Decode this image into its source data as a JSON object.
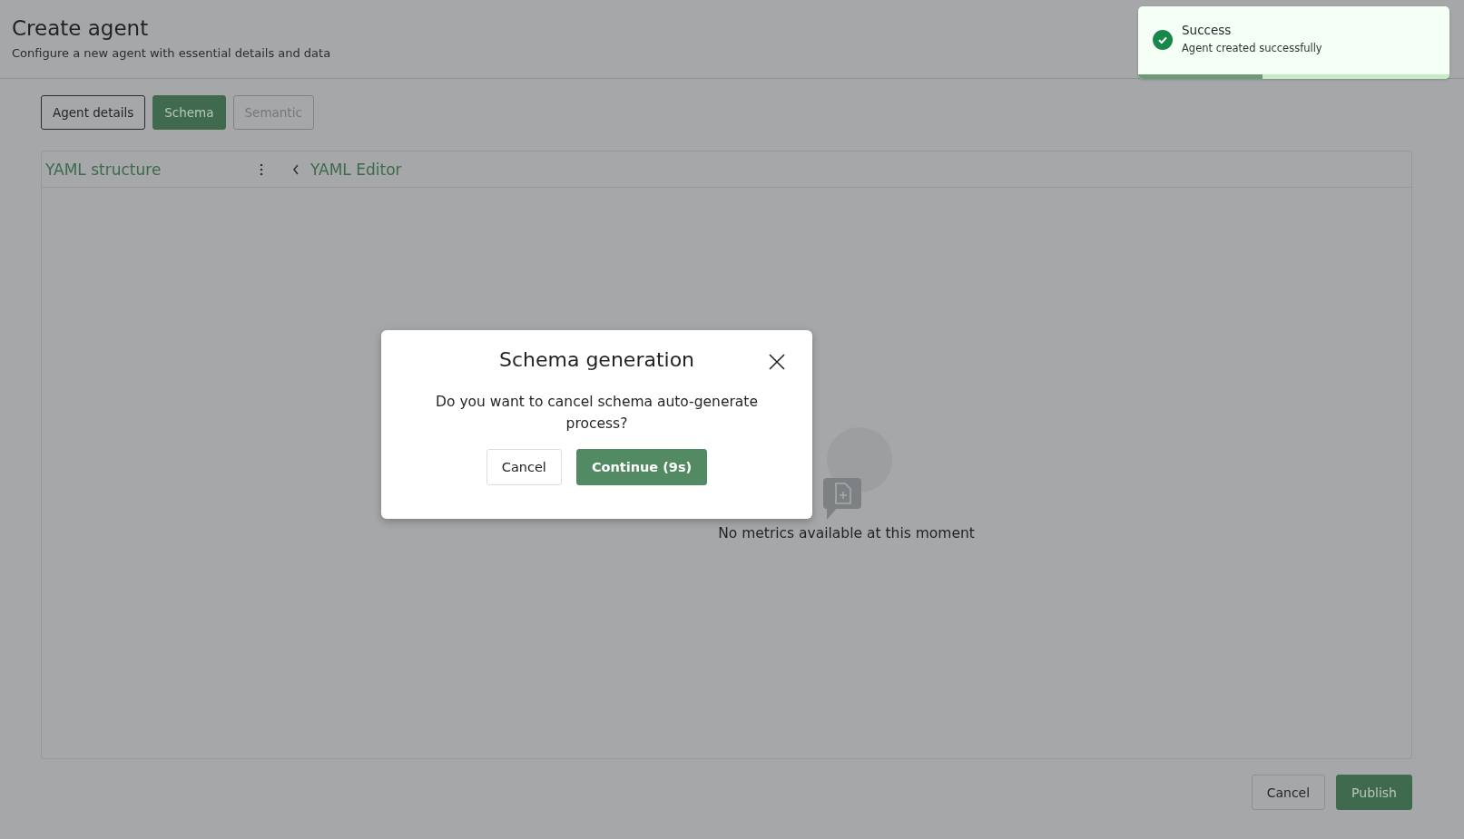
{
  "header": {
    "title": "Create agent",
    "subtitle": "Configure a new agent with essential details and data"
  },
  "tabs": [
    {
      "label": "Agent details",
      "selected": false,
      "disabled": false
    },
    {
      "label": "Schema",
      "selected": true,
      "disabled": false
    },
    {
      "label": "Semantic",
      "selected": false,
      "disabled": true
    }
  ],
  "structure_panel": {
    "title": "YAML structure"
  },
  "editor_panel": {
    "title": "YAML Editor",
    "empty_message": "No metrics available at this moment"
  },
  "footer_buttons": [
    {
      "label": "Cancel",
      "kind": "secondary"
    },
    {
      "label": "Publish",
      "kind": "primary"
    }
  ],
  "toast": {
    "title": "Success",
    "message": "Agent created successfully",
    "level": 0.4
  },
  "dialog": {
    "title": "Schema generation",
    "message": "Do you want to cancel schema auto-generate process?",
    "buttons": [
      {
        "label": "Cancel",
        "kind": "secondary"
      },
      {
        "label": "Continue (9s)",
        "kind": "primary"
      }
    ]
  }
}
